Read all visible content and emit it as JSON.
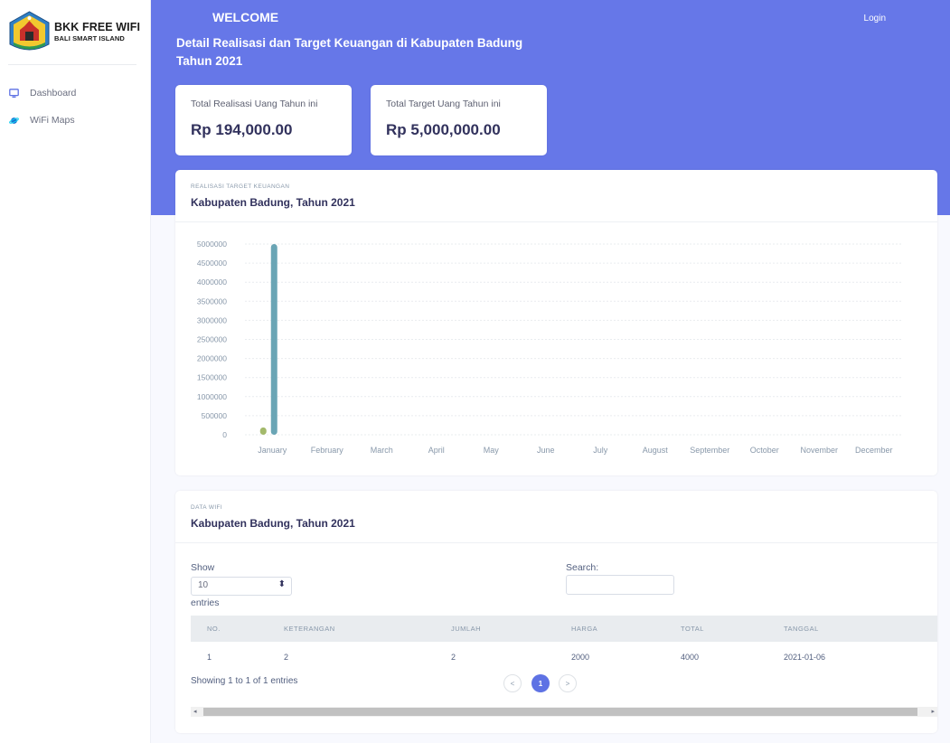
{
  "brand": {
    "title": "BKK FREE WIFI",
    "subtitle": "BALI SMART ISLAND"
  },
  "sidebar": {
    "items": [
      {
        "label": "Dashboard",
        "icon": "monitor-icon"
      },
      {
        "label": "WiFi Maps",
        "icon": "planet-icon"
      }
    ]
  },
  "header": {
    "welcome": "WELCOME",
    "login": "Login",
    "title": "Detail Realisasi dan Target Keuangan di Kabupaten Badung Tahun 2021"
  },
  "stats": [
    {
      "label": "Total Realisasi Uang Tahun ini",
      "value": "Rp 194,000.00"
    },
    {
      "label": "Total Target Uang Tahun ini",
      "value": "Rp 5,000,000.00"
    }
  ],
  "chart_card": {
    "pre": "REALISASI TARGET KEUANGAN",
    "title": "Kabupaten Badung, Tahun 2021"
  },
  "colors": {
    "accent": "#6677e8",
    "target_bar": "#6aa5b5",
    "realisasi_bar": "#a3b96b",
    "pager_active": "#5e72e4"
  },
  "chart_data": {
    "type": "bar",
    "categories": [
      "January",
      "February",
      "March",
      "April",
      "May",
      "June",
      "July",
      "August",
      "September",
      "October",
      "November",
      "December"
    ],
    "series": [
      {
        "values": [
          194000,
          0,
          0,
          0,
          0,
          0,
          0,
          0,
          0,
          0,
          0,
          0
        ],
        "color": "#a3b96b"
      },
      {
        "values": [
          5000000,
          0,
          0,
          0,
          0,
          0,
          0,
          0,
          0,
          0,
          0,
          0
        ],
        "color": "#6aa5b5"
      }
    ],
    "yticks": [
      "0",
      "500000",
      "1000000",
      "1500000",
      "2000000",
      "2500000",
      "3000000",
      "3500000",
      "4000000",
      "4500000",
      "5000000"
    ],
    "ylim": [
      0,
      5000000
    ],
    "grid": true,
    "legend": "none"
  },
  "table_card": {
    "pre": "DATA WIFI",
    "title": "Kabupaten Badung, Tahun 2021",
    "show_label": "Show",
    "entries_value": "10",
    "entries_label": "entries",
    "search_label": "Search:",
    "columns": [
      "NO.",
      "KETERANGAN",
      "JUMLAH",
      "HARGA",
      "TOTAL",
      "TANGGAL"
    ],
    "rows": [
      [
        "1",
        "2",
        "2",
        "2000",
        "4000",
        "2021-01-06"
      ]
    ],
    "info": "Showing 1 to 1 of 1 entries",
    "pager": {
      "prev": "<",
      "current": "1",
      "next": ">"
    }
  }
}
